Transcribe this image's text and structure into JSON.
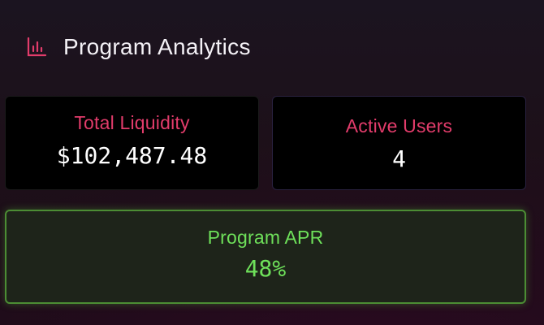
{
  "header": {
    "icon": "bar-chart-icon",
    "title": "Program Analytics"
  },
  "stats": {
    "total_liquidity": {
      "label": "Total Liquidity",
      "value": "$102,487.48"
    },
    "active_users": {
      "label": "Active Users",
      "value": "4"
    },
    "program_apr": {
      "label": "Program APR",
      "value": "48%"
    }
  },
  "colors": {
    "accent_pink": "#e23c6b",
    "accent_green": "#6ee05a",
    "apr_border": "#4c8d34"
  }
}
